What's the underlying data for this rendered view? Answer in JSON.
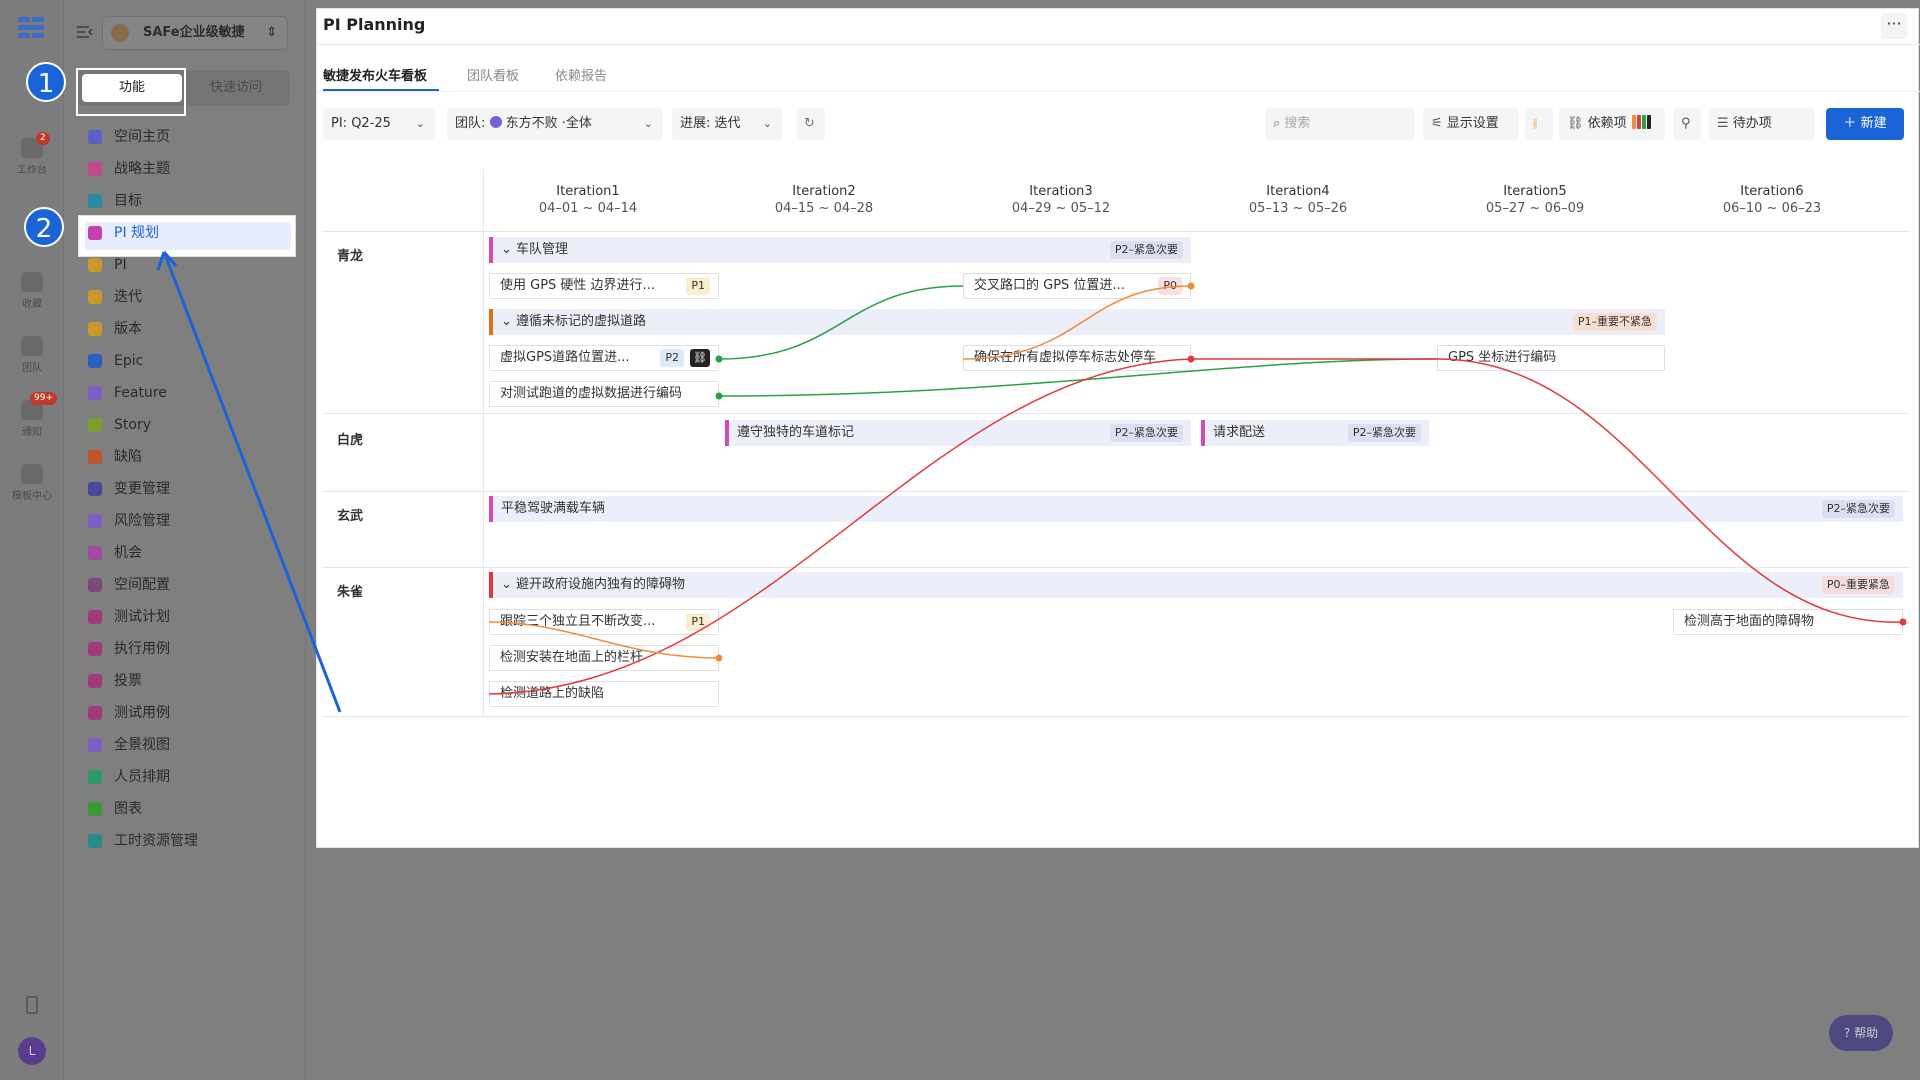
{
  "rail": {
    "items": [
      {
        "label": "工作台",
        "badge": "2"
      },
      {
        "label": "收藏"
      },
      {
        "label": "团队"
      },
      {
        "label": "通知",
        "badge": "99+"
      },
      {
        "label": "模板中心"
      }
    ],
    "avatar": "L"
  },
  "sidebar": {
    "space_name": "SAFe企业级敏捷",
    "tabs": [
      "功能",
      "快速访问"
    ],
    "items": [
      {
        "label": "空间主页",
        "color": "#5b5fc7"
      },
      {
        "label": "战略主题",
        "color": "#c04a8a"
      },
      {
        "label": "目标",
        "color": "#2a8aa0"
      },
      {
        "label": "PI 规划",
        "color": "#c83fb0"
      },
      {
        "label": "PI",
        "color": "#c89a2a"
      },
      {
        "label": "迭代",
        "color": "#c89a2a"
      },
      {
        "label": "版本",
        "color": "#c89a2a"
      },
      {
        "label": "Epic",
        "color": "#2a5fc0"
      },
      {
        "label": "Feature",
        "color": "#7a5fc7"
      },
      {
        "label": "Story",
        "color": "#7aa02a"
      },
      {
        "label": "缺陷",
        "color": "#c0552a"
      },
      {
        "label": "变更管理",
        "color": "#4a4a9a"
      },
      {
        "label": "风险管理",
        "color": "#7a5fc7"
      },
      {
        "label": "机会",
        "color": "#a04aa0"
      },
      {
        "label": "空间配置",
        "color": "#7a4a7a"
      },
      {
        "label": "测试计划",
        "color": "#a03a7a"
      },
      {
        "label": "执行用例",
        "color": "#a03a7a"
      },
      {
        "label": "投票",
        "color": "#a03a7a"
      },
      {
        "label": "测试用例",
        "color": "#a03a7a"
      },
      {
        "label": "全景视图",
        "color": "#7a5fc7"
      },
      {
        "label": "人员排期",
        "color": "#2a9a6a"
      },
      {
        "label": "图表",
        "color": "#3a9a3a"
      },
      {
        "label": "工时资源管理",
        "color": "#2a8a8a"
      }
    ]
  },
  "steps": [
    "1",
    "2"
  ],
  "main": {
    "title": "PI Planning",
    "more": "···",
    "tabs": [
      "敏捷发布火车看板",
      "团队看板",
      "依赖报告"
    ],
    "toolbar": {
      "pi_label": "PI:",
      "pi_value": "Q2-25",
      "team_label": "团队:",
      "team_value": "东方不败 ·全体",
      "progress_label": "进展:",
      "progress_value": "迭代",
      "search_placeholder": "搜索",
      "display_settings": "显示设置",
      "dependencies": "依赖项",
      "todo": "待办项",
      "new": "新建"
    }
  },
  "board": {
    "iterations": [
      {
        "name": "Iteration1",
        "dates": "04–01 ~ 04–14"
      },
      {
        "name": "Iteration2",
        "dates": "04–15 ~ 04–28"
      },
      {
        "name": "Iteration3",
        "dates": "04–29 ~ 05–12"
      },
      {
        "name": "Iteration4",
        "dates": "05–13 ~ 05–26"
      },
      {
        "name": "Iteration5",
        "dates": "05–27 ~ 06–09"
      },
      {
        "name": "Iteration6",
        "dates": "06–10 ~ 06–23"
      }
    ],
    "lanes": [
      "青龙",
      "白虎",
      "玄武",
      "朱雀"
    ],
    "features": [
      {
        "title": "车队管理",
        "tag": "P2–紧急次要"
      },
      {
        "title": "遵循未标记的虚拟道路",
        "tag": "P1–重要不紧急"
      },
      {
        "title": "遵守独特的车道标记",
        "tag": "P2–紧急次要"
      },
      {
        "title": "请求配送",
        "tag": "P2–紧急次要"
      },
      {
        "title": "平稳驾驶满载车辆",
        "tag": "P2–紧急次要"
      },
      {
        "title": "避开政府设施内独有的障碍物",
        "tag": "P0–重要紧急"
      }
    ],
    "cards": [
      {
        "title": "使用 GPS 硬性 边界进行...",
        "tag": "P1"
      },
      {
        "title": "交叉路口的 GPS 位置进...",
        "tag": "P0"
      },
      {
        "title": "虚拟GPS道路位置进...",
        "tag": "P2"
      },
      {
        "title": "确保在所有虚拟停车标志处停车"
      },
      {
        "title": "GPS 坐标进行编码"
      },
      {
        "title": "对测试跑道的虚拟数据进行编码"
      },
      {
        "title": "跟踪三个独立且不断改变...",
        "tag": "P1"
      },
      {
        "title": "检测安装在地面上的栏杆"
      },
      {
        "title": "检测道路上的缺陷"
      },
      {
        "title": "检测高于地面的障碍物"
      }
    ]
  },
  "help": "帮助"
}
